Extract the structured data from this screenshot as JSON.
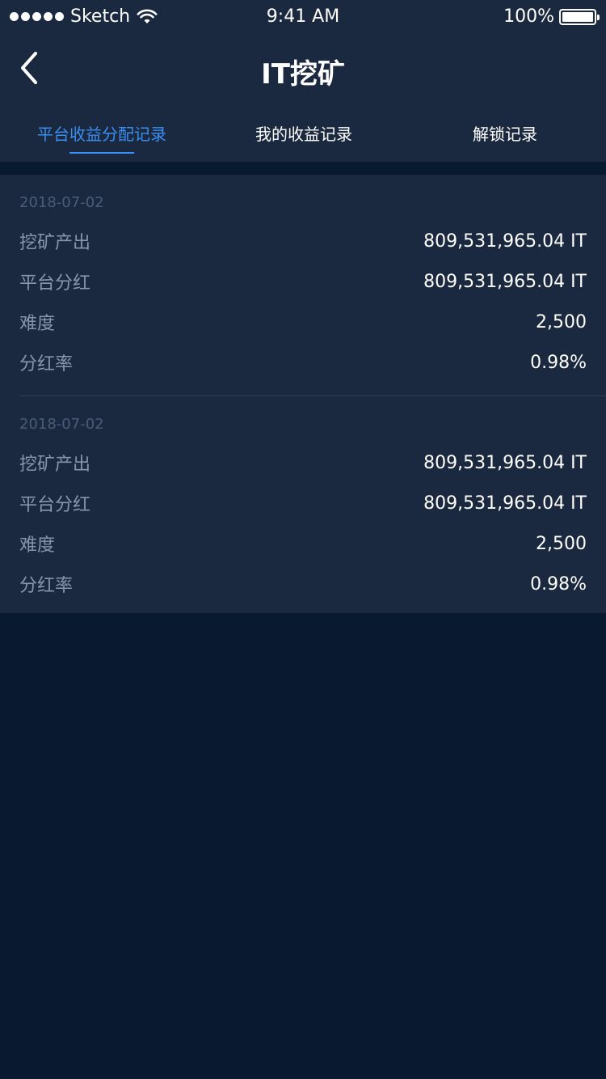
{
  "status_bar": {
    "carrier": "Sketch",
    "time": "9:41 AM",
    "battery": "100%",
    "signal_dots": 5
  },
  "header": {
    "title": "IT挖矿",
    "back_icon": "chevron-left-icon"
  },
  "tabs": [
    {
      "label": "平台收益分配记录",
      "active": true
    },
    {
      "label": "我的收益记录",
      "active": false
    },
    {
      "label": "解锁记录",
      "active": false
    }
  ],
  "records": [
    {
      "date": "2018-07-02",
      "rows": [
        {
          "label": "挖矿产出",
          "value": "809,531,965.04 IT"
        },
        {
          "label": "平台分红",
          "value": "809,531,965.04 IT"
        },
        {
          "label": "难度",
          "value": "2,500"
        },
        {
          "label": "分红率",
          "value": "0.98%"
        }
      ]
    },
    {
      "date": "2018-07-02",
      "rows": [
        {
          "label": "挖矿产出",
          "value": "809,531,965.04 IT"
        },
        {
          "label": "平台分红",
          "value": "809,531,965.04 IT"
        },
        {
          "label": "难度",
          "value": "2,500"
        },
        {
          "label": "分红率",
          "value": "0.98%"
        }
      ]
    }
  ],
  "colors": {
    "background": "#081930",
    "panel": "#1a2840",
    "accent": "#3a8ff0",
    "label": "#8796ae",
    "date": "#4b5c78"
  }
}
